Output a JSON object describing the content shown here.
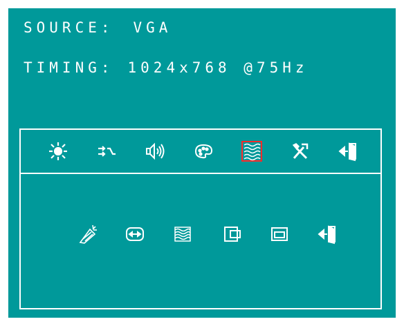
{
  "info": {
    "source_label": "SOURCE:",
    "source_value": "VGA",
    "timing_label": "TIMING:",
    "timing_value": "1024x768 @75Hz"
  },
  "main_menu": {
    "items": [
      {
        "icon": "brightness-icon"
      },
      {
        "icon": "input-select-icon"
      },
      {
        "icon": "volume-icon"
      },
      {
        "icon": "color-palette-icon"
      },
      {
        "icon": "image-setting-icon",
        "selected": true
      },
      {
        "icon": "tools-icon"
      },
      {
        "icon": "exit-icon"
      }
    ]
  },
  "sub_menu": {
    "items": [
      {
        "icon": "auto-adjust-icon"
      },
      {
        "icon": "clock-width-icon"
      },
      {
        "icon": "phase-icon"
      },
      {
        "icon": "h-position-icon"
      },
      {
        "icon": "v-position-icon"
      },
      {
        "icon": "exit-icon"
      }
    ]
  },
  "colors": {
    "osd_background": "#00999a",
    "foreground": "#ffffff",
    "selection": "#ff2a2a"
  }
}
